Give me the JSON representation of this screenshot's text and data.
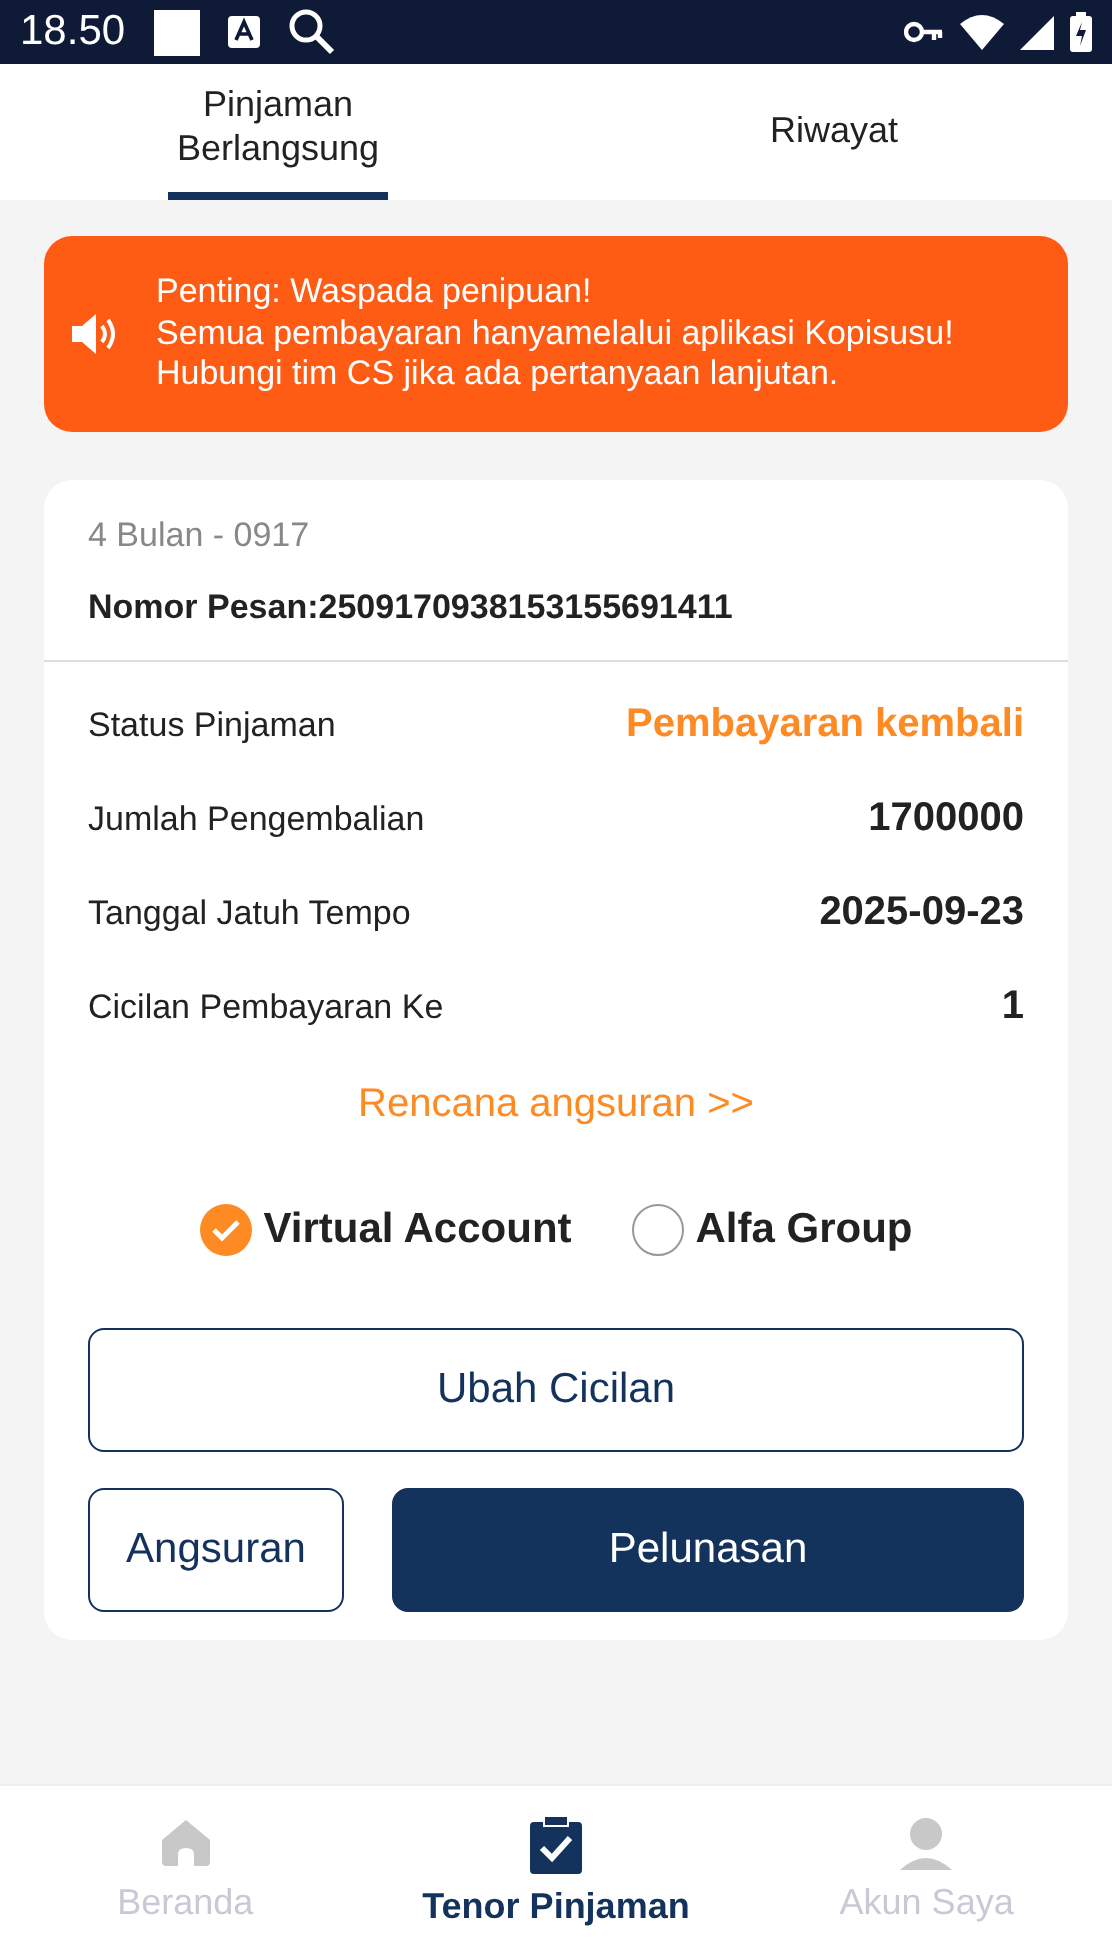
{
  "status_bar": {
    "time": "18.50"
  },
  "tabs": [
    {
      "label": "Pinjaman Berlangsung",
      "selected": true
    },
    {
      "label": "Riwayat",
      "selected": false
    }
  ],
  "notice": {
    "lines": [
      "Penting: Waspada penipuan!",
      "Semua pembayaran hanyamelalui aplikasi Kopisusu!",
      "Hubungi tim CS jika ada pertanyaan lanjutan."
    ]
  },
  "loan": {
    "tenor": "4 Bulan - 0917",
    "order_number": "Nomor Pesan:2509170938153155691411",
    "rows": [
      {
        "label": "Status Pinjaman",
        "value": "Pembayaran kembali",
        "kind": "status"
      },
      {
        "label": "Jumlah Pengembalian",
        "value": "1700000",
        "kind": "plain"
      },
      {
        "label": "Tanggal Jatuh Tempo",
        "value": "2025-09-23",
        "kind": "plain"
      },
      {
        "label": "Cicilan Pembayaran Ke",
        "value": "1",
        "kind": "plain"
      }
    ],
    "plan_link": "Rencana angsuran >>",
    "payment_methods": [
      {
        "label": "Virtual Account",
        "selected": true
      },
      {
        "label": "Alfa Group",
        "selected": false
      }
    ],
    "buttons": [
      {
        "label": "Ubah Cicilan",
        "kind": "outline"
      },
      {
        "label": "Angsuran",
        "kind": "outline"
      },
      {
        "label": "Pelunasan",
        "kind": "filled"
      }
    ]
  },
  "bottom_nav": [
    {
      "label": "Beranda",
      "selected": false
    },
    {
      "label": "Tenor Pinjaman",
      "selected": true
    },
    {
      "label": "Akun Saya",
      "selected": false
    }
  ]
}
